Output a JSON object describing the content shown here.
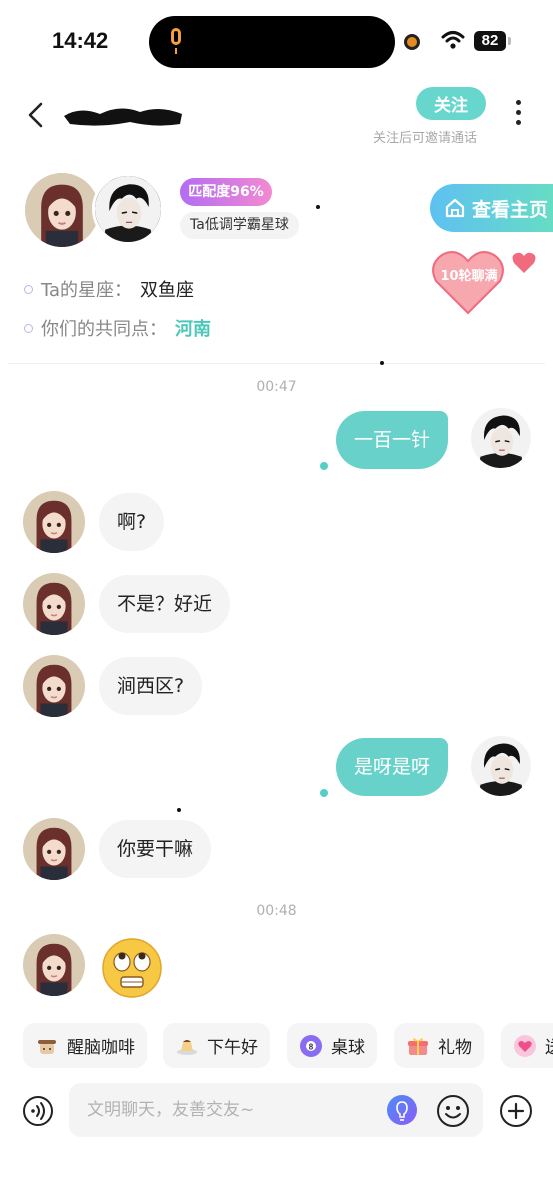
{
  "status_bar": {
    "time": "14:42",
    "battery": "82"
  },
  "header": {
    "follow_label": "关注",
    "follow_hint": "关注后可邀请通话"
  },
  "profile": {
    "match_badge": "匹配度96%",
    "tag": "Ta低调学霸星球",
    "homepage_label": "查看主页",
    "rounds_badge": "10轮聊满",
    "zodiac_label": "Ta的星座：",
    "zodiac_value": "双鱼座",
    "common_label": "你们的共同点：",
    "common_value": "河南"
  },
  "chat": {
    "timestamps": [
      "00:47",
      "00:48"
    ],
    "messages": [
      {
        "side": "out",
        "text": "一百一针"
      },
      {
        "side": "in",
        "text": "啊?"
      },
      {
        "side": "in",
        "text": "不是？好近"
      },
      {
        "side": "in",
        "text": "涧西区?"
      },
      {
        "side": "out",
        "text": "是呀是呀"
      },
      {
        "side": "in",
        "text": "你要干嘛"
      },
      {
        "side": "in",
        "emoji": "rolling-eyes-face"
      }
    ]
  },
  "quick_replies": [
    {
      "label": "醒脑咖啡",
      "icon": "coffee-cup-icon"
    },
    {
      "label": "下午好",
      "icon": "pudding-icon"
    },
    {
      "label": "桌球",
      "icon": "billiard-ball-icon"
    },
    {
      "label": "礼物",
      "icon": "gift-icon"
    },
    {
      "label": "送",
      "icon": "heart-bubble-icon"
    }
  ],
  "input": {
    "placeholder": "文明聊天，友善交友~"
  },
  "colors": {
    "accent": "#67d1ca",
    "badge_gradient_start": "#b36cf2",
    "badge_gradient_end": "#f28ad1",
    "heart": "#f06b7d"
  }
}
